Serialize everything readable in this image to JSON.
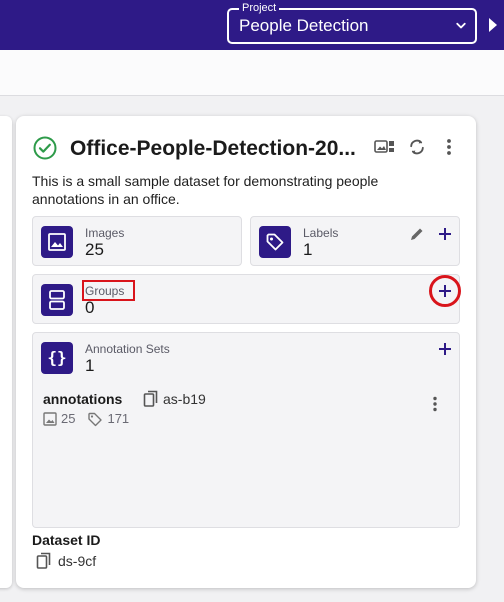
{
  "topbar": {
    "project_label": "Project",
    "project_value": "People Detection"
  },
  "dataset": {
    "title": "Office-People-Detection-20...",
    "description": "This is a small sample dataset for demonstrating people annotations in an office.",
    "images": {
      "label": "Images",
      "value": "25"
    },
    "labels": {
      "label": "Labels",
      "value": "1"
    },
    "groups": {
      "label": "Groups",
      "value": "0"
    },
    "annotation_sets": {
      "label": "Annotation Sets",
      "value": "1",
      "items": [
        {
          "name": "annotations",
          "id": "as-b19",
          "image_count": "25",
          "label_count": "171"
        }
      ]
    },
    "dataset_id_label": "Dataset ID",
    "dataset_id_value": "ds-9cf"
  },
  "colors": {
    "brand": "#2e1a87",
    "success": "#2e9b4a",
    "highlight": "#d9141b"
  },
  "icons": {
    "status": "check-circle-icon",
    "images": "image-icon",
    "labels": "tag-icon",
    "groups": "group-icon",
    "annotation_sets": "braces-icon"
  }
}
